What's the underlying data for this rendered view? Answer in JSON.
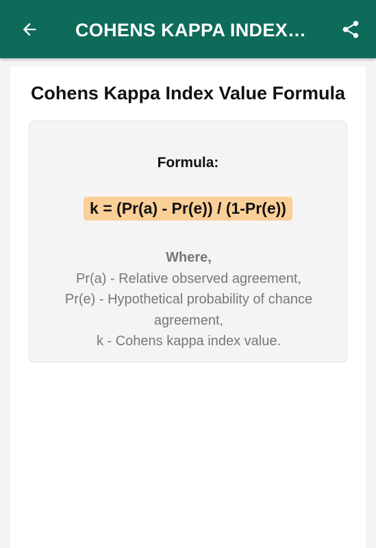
{
  "app_bar": {
    "title": "COHENS KAPPA INDEX…",
    "background_color": "#0e6b5a",
    "back_icon": "arrow-left-icon",
    "share_icon": "share-icon"
  },
  "page": {
    "title": "Cohens Kappa Index Value Formula"
  },
  "formula_card": {
    "label": "Formula:",
    "expression": "k = (Pr(a) - Pr(e)) / (1-Pr(e))",
    "highlight_color": "#fbcf98",
    "where_title": "Where,",
    "definitions": [
      "Pr(a) - Relative observed agreement,",
      "Pr(e) - Hypothetical probability of chance agreement,",
      "k - Cohens kappa index value."
    ]
  }
}
